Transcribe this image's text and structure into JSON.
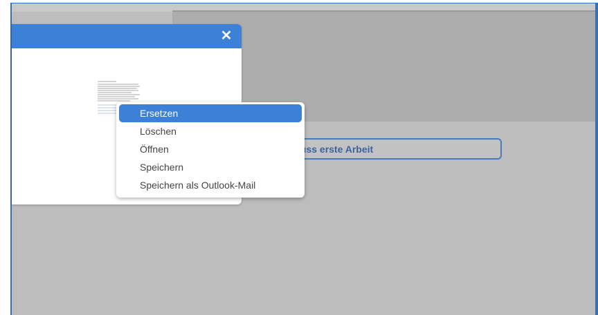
{
  "dialog": {
    "close_label": "✕"
  },
  "background": {
    "field_button_label": "luss erste Arbeit"
  },
  "context_menu": {
    "items": [
      {
        "label": "Ersetzen",
        "selected": true
      },
      {
        "label": "Löschen",
        "selected": false
      },
      {
        "label": "Öffnen",
        "selected": false
      },
      {
        "label": "Speichern",
        "selected": false
      },
      {
        "label": "Speichern als Outlook-Mail",
        "selected": false
      }
    ]
  },
  "colors": {
    "accent": "#3c80d8",
    "backdrop": "#bdbdbd",
    "field_text": "#3b64a0"
  }
}
